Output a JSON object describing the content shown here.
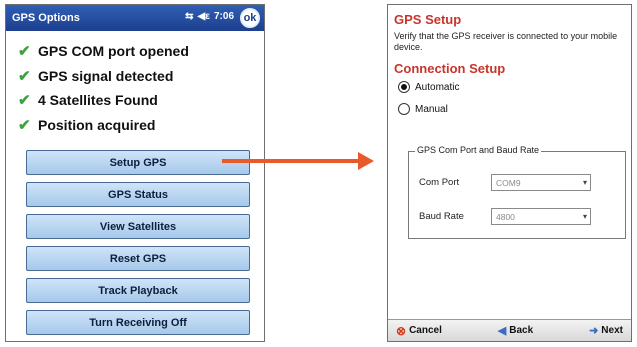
{
  "left_screen": {
    "window_title": "GPS Options",
    "tray_time": "7:06",
    "status_items": [
      {
        "label": "GPS COM port opened"
      },
      {
        "label": "GPS signal detected"
      },
      {
        "label": "4 Satellites Found"
      },
      {
        "label": "Position acquired"
      }
    ],
    "buttons": [
      {
        "label": "Setup GPS"
      },
      {
        "label": "GPS Status"
      },
      {
        "label": "View Satellites"
      },
      {
        "label": "Reset GPS"
      },
      {
        "label": "Track Playback"
      },
      {
        "label": "Turn Receiving Off"
      }
    ]
  },
  "right_screen": {
    "title": "GPS Setup",
    "description": "Verify that the GPS receiver is connected to your mobile device.",
    "section_title": "Connection Setup",
    "radio_automatic": "Automatic",
    "radio_manual": "Manual",
    "selected_mode": "Automatic",
    "group_title": "GPS Com Port and Baud Rate",
    "com_port_label": "Com Port",
    "com_port_value": "COM9",
    "baud_rate_label": "Baud Rate",
    "baud_rate_value": "4800",
    "softkeys": {
      "cancel": "Cancel",
      "back": "Back",
      "next": "Next"
    }
  },
  "colors": {
    "accent_red": "#c8352b",
    "arrow": "#e85a2a",
    "titlebar": "#1d3f8e",
    "check_green": "#3ea23e"
  },
  "icons": [
    "check-icon",
    "connectivity-icon",
    "volume-icon",
    "ok-icon",
    "cancel-icon",
    "back-icon",
    "next-icon",
    "dropdown-icon"
  ]
}
